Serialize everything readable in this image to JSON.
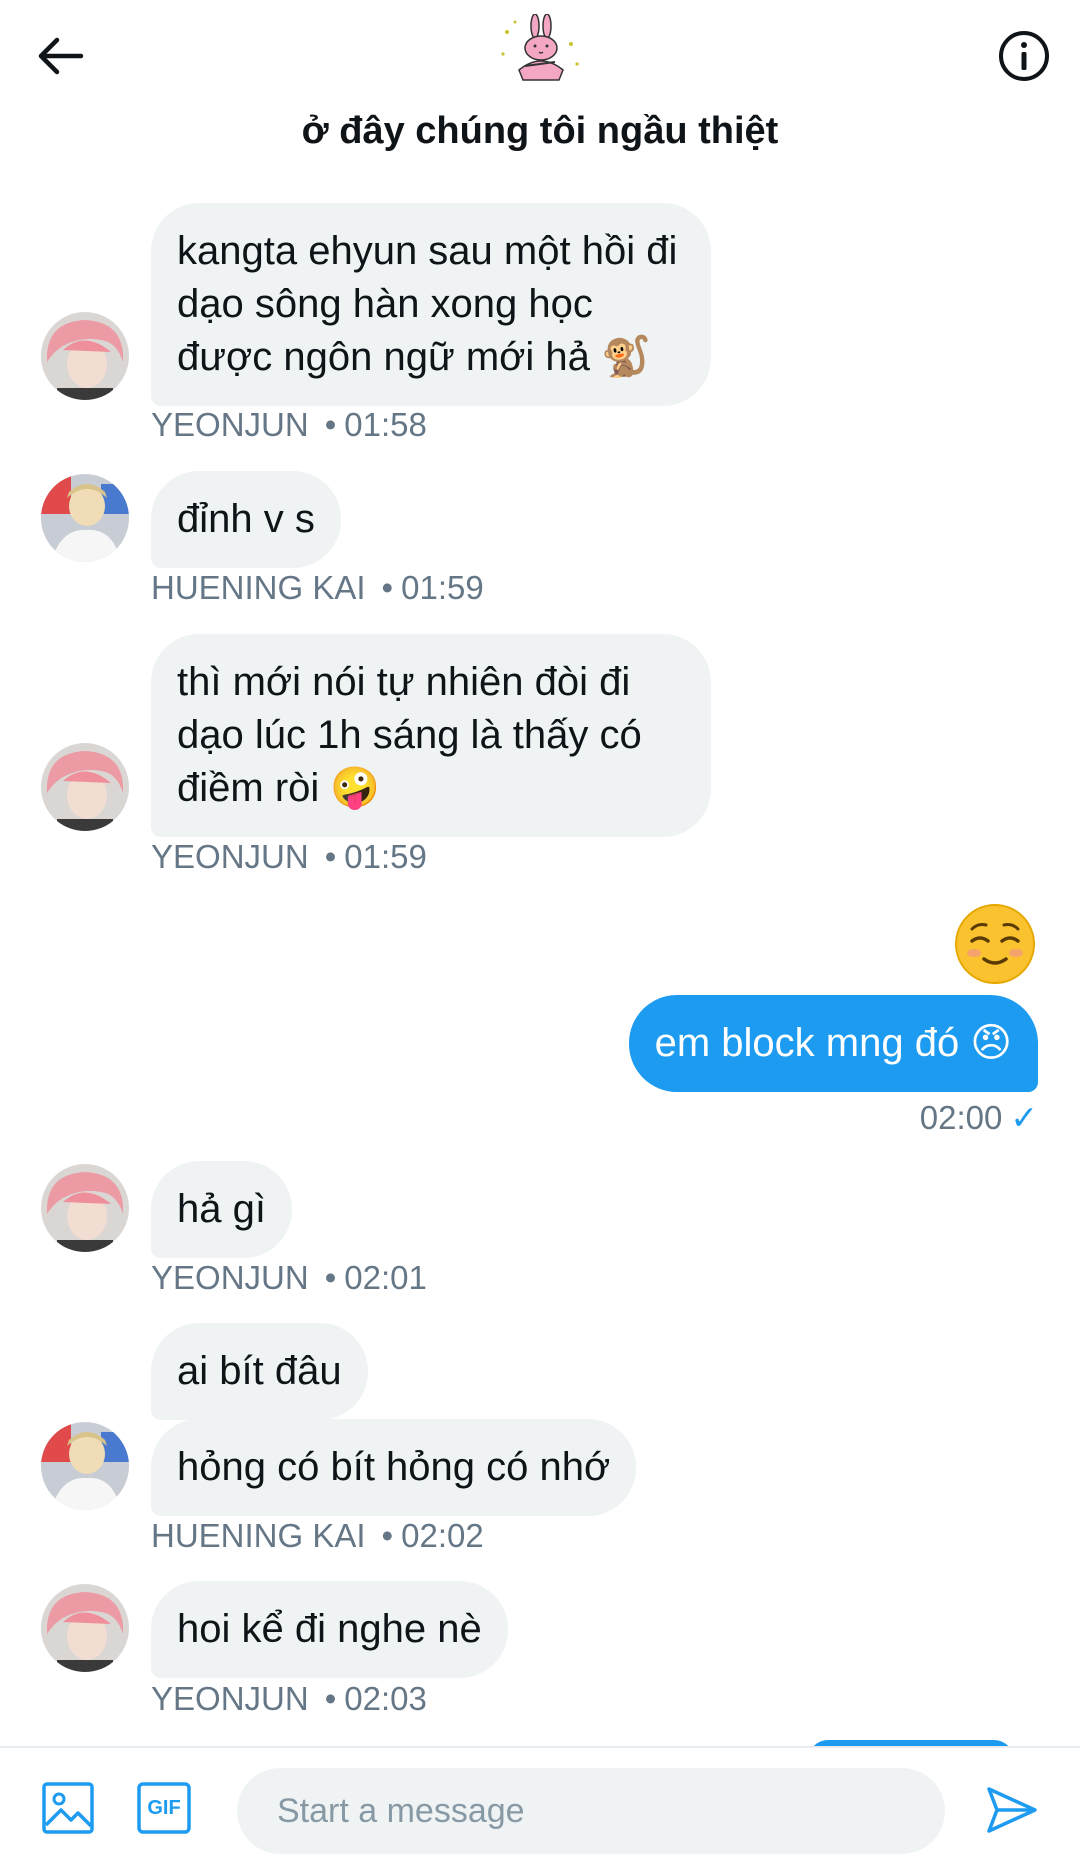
{
  "header": {
    "title": "ở đây chúng tôi ngầu thiệt",
    "back_icon": "arrow-left-icon",
    "info_icon": "info-icon",
    "group_avatar": "pink-rabbit-sticker"
  },
  "messages": [
    {
      "sender": "YEONJUN",
      "time": "01:58",
      "text": "kangta ehyun sau một hồi đi dạo sông hàn xong học được ngôn ngữ mới hả 🐒"
    },
    {
      "sender": "HUENING KAI",
      "time": "01:59",
      "text": "đỉnh v s"
    },
    {
      "sender": "YEONJUN",
      "time": "01:59",
      "text": "thì mới nói tự nhiên đòi đi dạo lúc 1h sáng là thấy có điềm ròi 🤪"
    },
    {
      "sender": "me",
      "emoji": "☺️",
      "text": "em block mng đó 😠",
      "time": "02:00",
      "status": "✓"
    },
    {
      "sender": "YEONJUN",
      "time": "02:01",
      "text": "hả gì"
    },
    {
      "sender": "HUENING KAI",
      "time": "02:02",
      "text_1": "ai bít đâu",
      "text_2": "hỏng có bít hỏng có nhớ"
    },
    {
      "sender": "YEONJUN",
      "time": "02:03",
      "text": "hoi kể đi nghe nè"
    }
  ],
  "composer": {
    "placeholder": "Start a message",
    "gif_label": "GIF",
    "image_icon": "image-icon",
    "send_icon": "send-icon"
  },
  "colors": {
    "accent": "#1d9bf0",
    "bubble_in": "#eff3f4",
    "meta_text": "#657786"
  }
}
